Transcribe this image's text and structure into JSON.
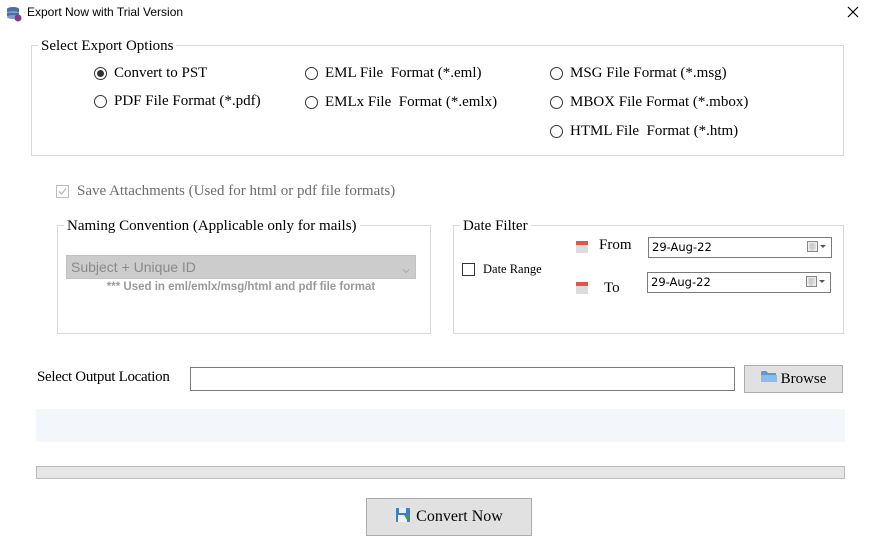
{
  "window": {
    "title": "Export Now with Trial Version",
    "icon": "app-database-icon",
    "close_icon": "close-icon"
  },
  "export_options": {
    "group_label": "Select Export Options",
    "selected": "pst",
    "options": [
      {
        "id": "pst",
        "label": "Convert to PST",
        "checked": true
      },
      {
        "id": "pdf",
        "label": "PDF File Format (*.pdf)",
        "checked": false
      },
      {
        "id": "eml",
        "label": "EML File  Format (*.eml)",
        "checked": false
      },
      {
        "id": "emlx",
        "label": "EMLx File  Format (*.emlx)",
        "checked": false
      },
      {
        "id": "msg",
        "label": "MSG File Format (*.msg)",
        "checked": false
      },
      {
        "id": "mbox",
        "label": "MBOX File Format (*.mbox)",
        "checked": false
      },
      {
        "id": "html",
        "label": "HTML File  Format (*.htm)",
        "checked": false
      }
    ]
  },
  "save_attachments": {
    "label": "Save Attachments (Used for html or pdf file formats)",
    "checked": true,
    "disabled": true
  },
  "naming_convention": {
    "group_label": "Naming Convention (Applicable only for mails)",
    "selected_value": "Subject + Unique ID",
    "note": "*** Used in eml/emlx/msg/html and pdf file format",
    "disabled": true
  },
  "date_filter": {
    "group_label": "Date Filter",
    "date_range_label": "Date Range",
    "date_range_checked": false,
    "from_label": "From",
    "from_value": "29-Aug-22",
    "to_label": "To",
    "to_value": "29-Aug-22",
    "calendar_icon": "calendar-icon"
  },
  "output": {
    "label": "Select Output Location",
    "value": "",
    "browse_label": "Browse",
    "browse_icon": "folder-icon"
  },
  "status": {
    "text": "",
    "progress": 0
  },
  "convert": {
    "label": "Convert Now",
    "icon": "save-disk-icon"
  },
  "colors": {
    "button_bg": "#e1e1e1",
    "status_bg": "#f3f6fa",
    "disabled_combo_bg": "#cccccc",
    "calendar_red": "#e2554c",
    "folder_blue": "#5b9bd5"
  }
}
